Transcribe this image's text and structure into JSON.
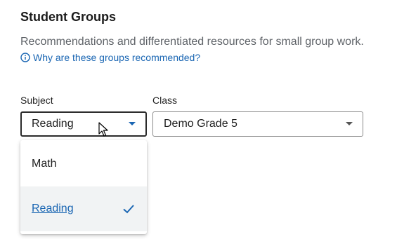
{
  "header": {
    "title": "Student Groups",
    "subtitle": "Recommendations and differentiated resources for small group work.",
    "why_link": "Why are these groups recommended?"
  },
  "filters": {
    "subject": {
      "label": "Subject",
      "value": "Reading",
      "options": [
        "Math",
        "Reading"
      ],
      "selected_option": "Reading",
      "menu_open": true
    },
    "class": {
      "label": "Class",
      "value": "Demo Grade 5"
    }
  },
  "icons": {
    "info": "info-circle-icon",
    "caret": "caret-down-icon",
    "check": "check-icon",
    "cursor": "mouse-pointer-icon"
  },
  "colors": {
    "link": "#1a66b3",
    "text": "#1f1f1f",
    "muted": "#5f6368",
    "selected_bg": "#f1f3f4"
  }
}
